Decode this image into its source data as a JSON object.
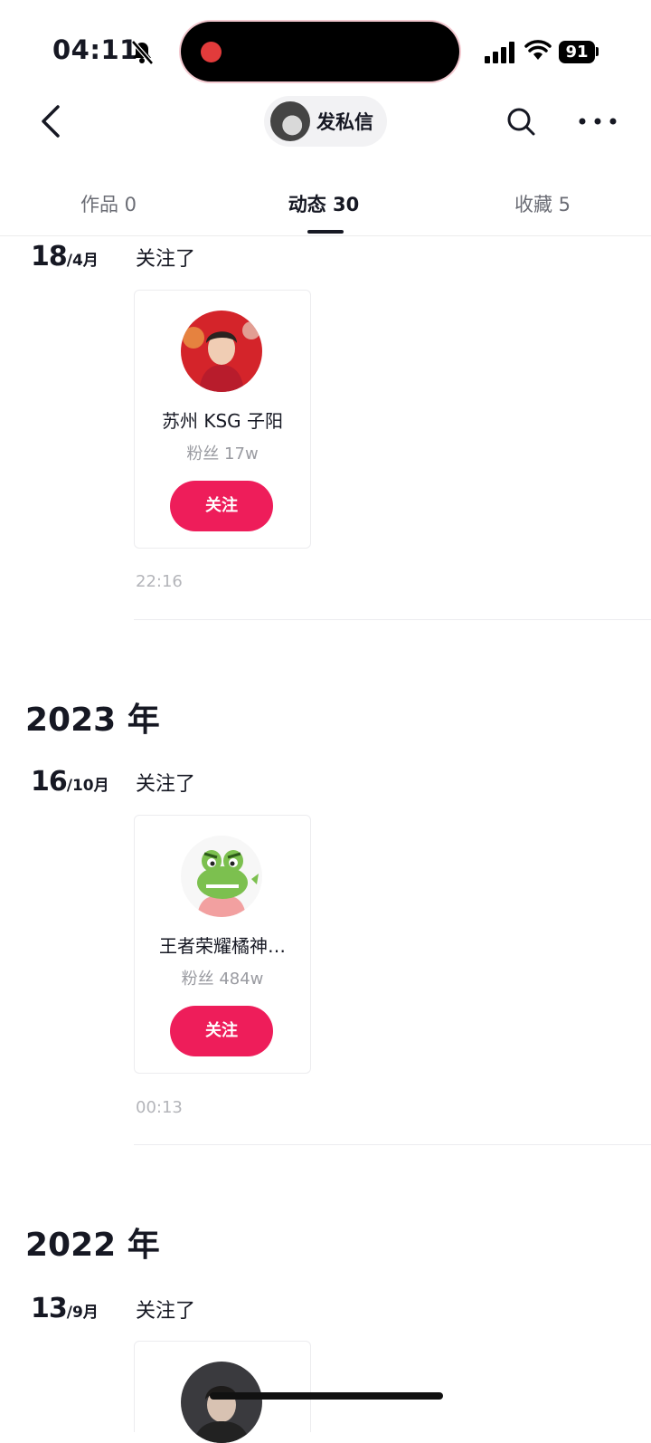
{
  "status_bar": {
    "time": "04:11",
    "battery": "91"
  },
  "header": {
    "private_message_label": "发私信"
  },
  "tabs": [
    {
      "label": "作品 0"
    },
    {
      "label": "动态 30"
    },
    {
      "label": "收藏 5"
    }
  ],
  "feed": {
    "entries": [
      {
        "day": "18",
        "month": "/4月",
        "action": "关注了",
        "user": {
          "name": "苏州 KSG 子阳",
          "fans": "粉丝 17w",
          "follow_label": "关注"
        },
        "time": "22:16"
      },
      {
        "year": "2023 年",
        "day": "16",
        "month": "/10月",
        "action": "关注了",
        "user": {
          "name": "王者荣耀橘神…",
          "fans": "粉丝 484w",
          "follow_label": "关注"
        },
        "time": "00:13"
      },
      {
        "year": "2022 年",
        "day": "13",
        "month": "/9月",
        "action": "关注了"
      }
    ]
  },
  "colors": {
    "accent": "#ee1d5a",
    "text": "#161823",
    "muted": "#9a9ba1"
  }
}
